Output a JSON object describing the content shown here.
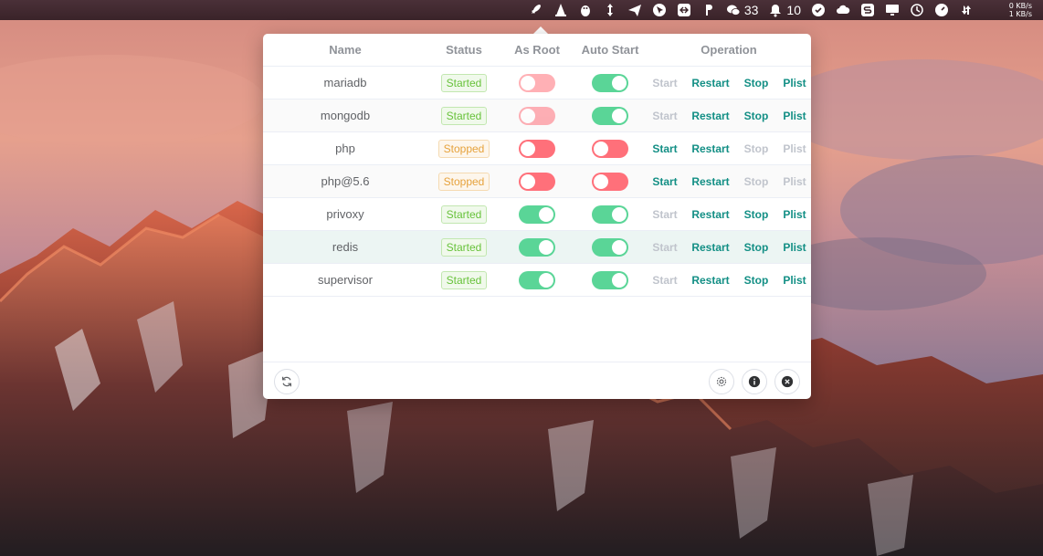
{
  "menubar": {
    "wechat_count": "33",
    "qq_count": "10",
    "net_upload": "0 KB/s",
    "net_download": "1 KB/s"
  },
  "table": {
    "headers": {
      "name": "Name",
      "status": "Status",
      "as_root": "As Root",
      "auto_start": "Auto Start",
      "operation": "Operation"
    },
    "rows": [
      {
        "name": "mariadb",
        "status": "Started",
        "as_root": false,
        "auto_start": true,
        "start": "Start",
        "restart": "Restart",
        "stop": "Stop",
        "plist": "Plist"
      },
      {
        "name": "mongodb",
        "status": "Started",
        "as_root": false,
        "auto_start": true,
        "start": "Start",
        "restart": "Restart",
        "stop": "Stop",
        "plist": "Plist"
      },
      {
        "name": "php",
        "status": "Stopped",
        "as_root": false,
        "auto_start": false,
        "start": "Start",
        "restart": "Restart",
        "stop": "Stop",
        "plist": "Plist"
      },
      {
        "name": "php@5.6",
        "status": "Stopped",
        "as_root": false,
        "auto_start": false,
        "start": "Start",
        "restart": "Restart",
        "stop": "Stop",
        "plist": "Plist"
      },
      {
        "name": "privoxy",
        "status": "Started",
        "as_root": true,
        "auto_start": true,
        "start": "Start",
        "restart": "Restart",
        "stop": "Stop",
        "plist": "Plist"
      },
      {
        "name": "redis",
        "status": "Started",
        "as_root": true,
        "auto_start": true,
        "start": "Start",
        "restart": "Restart",
        "stop": "Stop",
        "plist": "Plist"
      },
      {
        "name": "supervisor",
        "status": "Started",
        "as_root": true,
        "auto_start": true,
        "start": "Start",
        "restart": "Restart",
        "stop": "Stop",
        "plist": "Plist"
      }
    ]
  },
  "footer": {
    "left_icon": "refresh-icon",
    "right_icons": [
      "settings-icon",
      "info-icon",
      "close-icon"
    ]
  },
  "colors": {
    "accent": "#138f85",
    "switch_on": "#5ad597",
    "switch_off": "#ff707a",
    "started": "#67c23a",
    "stopped": "#e6a23c"
  }
}
